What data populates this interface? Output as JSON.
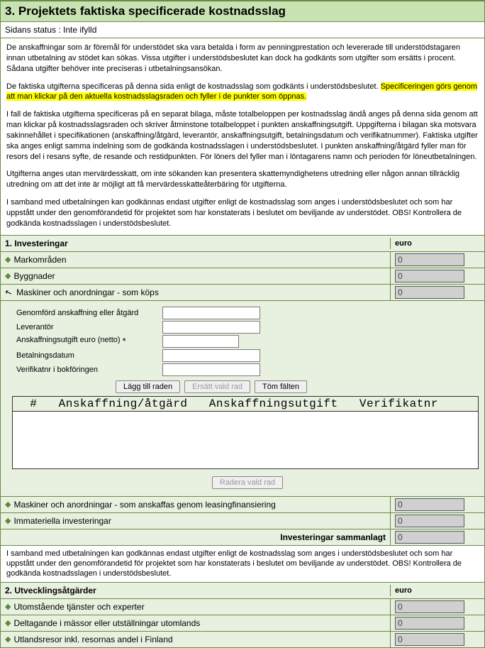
{
  "section_title": "3. Projektets faktiska specificerade kostnadsslag",
  "status_line": "Sidans status : Inte ifylld",
  "intro_paragraphs": [
    "De anskaffningar som är föremål för understödet ska vara betalda i form av penningprestation och levererade till understödstagaren innan utbetalning av stödet kan sökas. Vissa utgifter i understödsbeslutet kan dock ha godkänts som utgifter som ersätts i procent. Sådana utgifter behöver inte preciseras i utbetalningsansökan.",
    "De faktiska utgifterna specificeras på denna sida enligt de kostnadsslag som godkänts i understödsbeslutet.",
    "I fall de faktiska utgifterna specificeras på en separat bilaga, måste totalbeloppen per kostnadsslag ändå anges på denna sida genom att man klickar på kostnadsslagsraden och skriver åtminstone totalbeloppet i punkten anskaffningsutgift. Uppgifterna i bilagan ska motsvara sakinnehållet i specifikationen (anskaffning/åtgärd, leverantör, anskaffningsutgift, betalningsdatum och verifikatnummer). Faktiska utgifter ska anges enligt samma indelning som de godkända kostnadsslagen i understödsbeslutet. I punkten anskaffning/åtgärd fyller man för resors del i resans syfte, de resande och restidpunkten. För löners del fyller man i löntagarens namn och perioden för löneutbetalningen.",
    "Utgifterna anges utan mervärdesskatt, om inte sökanden kan presentera skattemyndighetens utredning eller någon annan tillräcklig utredning om att det inte är möjligt att få mervärdesskatteåterbäring för utgifterna.",
    "I samband med utbetalningen kan godkännas endast utgifter enligt de kostnadsslag som anges i understödsbeslutet och som har uppstått under den genomförandetid för projektet som har konstaterats i beslutet om beviljande av understödet. OBS! Kontrollera de godkända kostnadsslagen i understödsbeslutet."
  ],
  "highlight_text": "Specificeringen görs genom att man klickar på den aktuella kostnadsslagsraden och fyller i de punkter som öppnas.",
  "group1": {
    "title": "1. Investeringar",
    "currency": "euro",
    "rows": [
      {
        "label": "Markområden",
        "value": "0"
      },
      {
        "label": "Byggnader",
        "value": "0"
      }
    ],
    "expanded_label": "Maskiner och anordningar - som köps",
    "expanded_value": "0",
    "fields": {
      "f1": "Genomförd anskaffning eller åtgärd",
      "f2": "Leverantör",
      "f3": "Anskaffningsutgift euro (netto)",
      "f4": "Betalningsdatum",
      "f5": "Verifikatnr i bokföringen"
    },
    "buttons": {
      "add": "Lägg till raden",
      "replace": "Ersätt vald rad",
      "clear": "Töm fälten",
      "delete": "Radera vald rad"
    },
    "list_header": "  #   Anskaffning/åtgärd   Anskaffningsutgift   Verifikatnr",
    "rows_after": [
      {
        "label": "Maskiner och anordningar - som anskaffas genom leasingfinansiering",
        "value": "0"
      },
      {
        "label": "Immateriella investeringar",
        "value": "0"
      }
    ],
    "sum_label": "Investeringar sammanlagt",
    "sum_value": "0"
  },
  "note_between": "I samband med utbetalningen kan godkännas endast utgifter enligt de kostnadsslag som anges i understödsbeslutet och som har uppstått under den genomförandetid för projektet som har konstaterats i beslutet om beviljande av understödet. OBS! Kontrollera de godkända kostnadsslagen i understödsbeslutet.",
  "group2": {
    "title": "2. Utvecklingsåtgärder",
    "currency": "euro",
    "rows": [
      {
        "label": "Utomstående tjänster och experter",
        "value": "0"
      },
      {
        "label": "Deltagande i mässor eller utställningar utomlands",
        "value": "0"
      },
      {
        "label": "Utlandsresor inkl. resornas andel i Finland",
        "value": "0"
      }
    ]
  }
}
